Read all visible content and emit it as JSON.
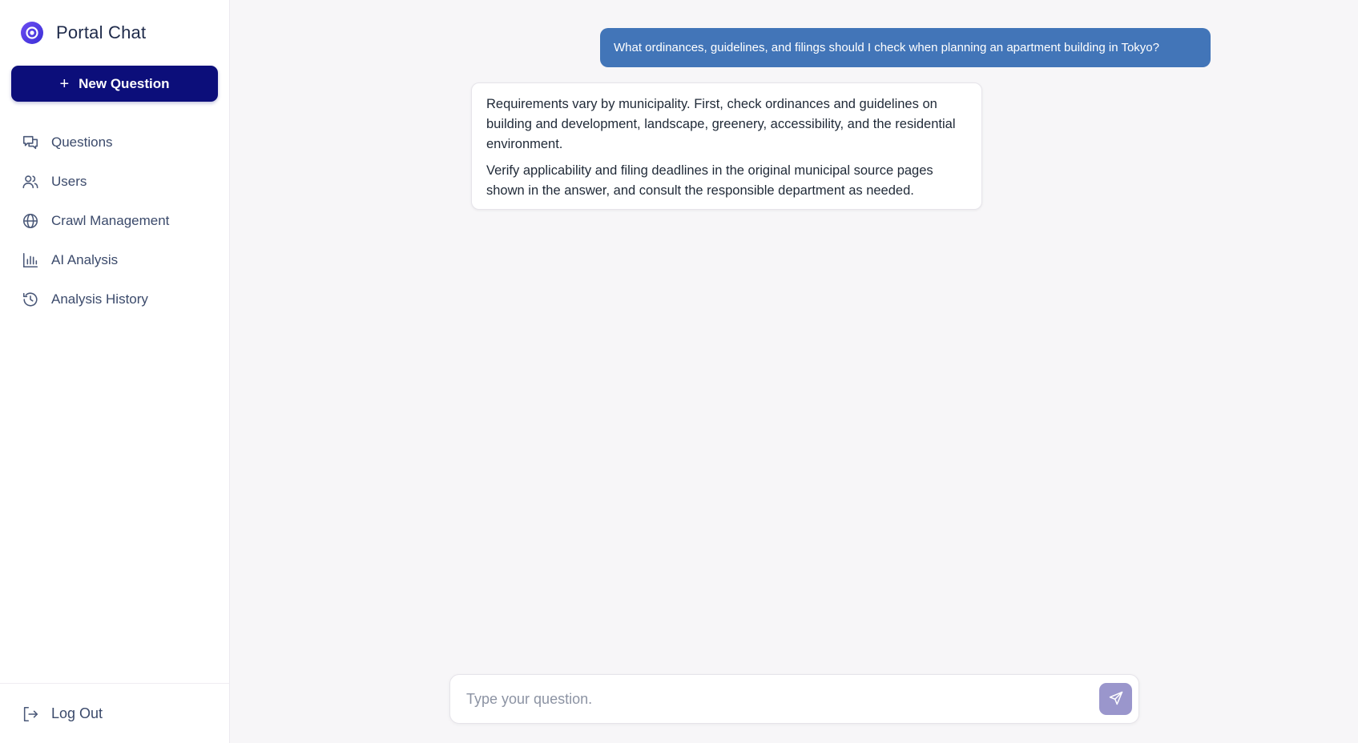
{
  "app": {
    "title": "Portal Chat"
  },
  "sidebar": {
    "new_question_label": "New Question",
    "items": [
      {
        "label": "Questions",
        "icon": "chat-bubbles-icon"
      },
      {
        "label": "Users",
        "icon": "users-icon"
      },
      {
        "label": "Crawl Management",
        "icon": "globe-icon"
      },
      {
        "label": "AI Analysis",
        "icon": "bar-chart-icon"
      },
      {
        "label": "Analysis History",
        "icon": "history-icon"
      }
    ],
    "logout_label": "Log Out"
  },
  "chat": {
    "user_message": "What ordinances, guidelines, and filings should I check when planning an apartment building in Tokyo?",
    "assistant_paragraphs": [
      "Requirements vary by municipality. First, check ordinances and guidelines on building and development, landscape, greenery, accessibility, and the residential environment.",
      "Verify applicability and filing deadlines in the original municipal source pages shown in the answer, and consult the responsible department as needed."
    ]
  },
  "composer": {
    "placeholder": "Type your question.",
    "value": ""
  },
  "colors": {
    "brand": "#0c0e7a",
    "user_bubble": "#4275b8",
    "send_button": "#9a96cc",
    "logo": "#5a3ff0"
  }
}
